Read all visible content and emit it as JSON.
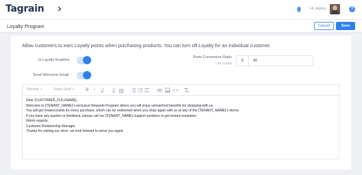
{
  "header": {
    "logo_text": "Tagrain",
    "greeting": "Hi, Admin"
  },
  "subheader": {
    "title": "Loyalty Program",
    "cancel_label": "Cancel",
    "save_label": "Save"
  },
  "settings": {
    "intro": "Allow customers to earn Loyalty points when purchasing products. You can turn off Loyalty for an individual customer.",
    "loyalty_enabled_label": "Is Loyalty Enabled",
    "loyalty_enabled": true,
    "send_welcome_email_label": "Send Welcome Email",
    "send_welcome_email": true,
    "conversion_label": "Point Conversion Ratio",
    "conversion_sub": "= $1 Loyalty",
    "conversion_prefix": "$",
    "conversion_value": "20"
  },
  "editor": {
    "toolbar": {
      "format": "Normal",
      "font": "Sans Serif",
      "bold": "B",
      "italic": "I",
      "underline": "U",
      "text_color": "A"
    },
    "lines": [
      "Dear {CUSTOMER_FULLNAME},",
      "Welcome to {TENANT_NAME}'s exclusive Rewards Program where you will enjoy unmatched benefits for shopping with us.",
      "You will get reward points for every purchase, which can be redeemed when you shop again with us at any of the {TENANT_NAME}'s stores.",
      "If you have any queries or feedback, please call our {TENANT_NAME} support numbers to get instant resolution.",
      "Warm regards,",
      "Customer Relationship Manager",
      "Thanks for visiting our store. we look forward to serve you again."
    ]
  },
  "colors": {
    "accent": "#2f80ed",
    "brand": "#1e3550",
    "background": "#eef0f4"
  }
}
